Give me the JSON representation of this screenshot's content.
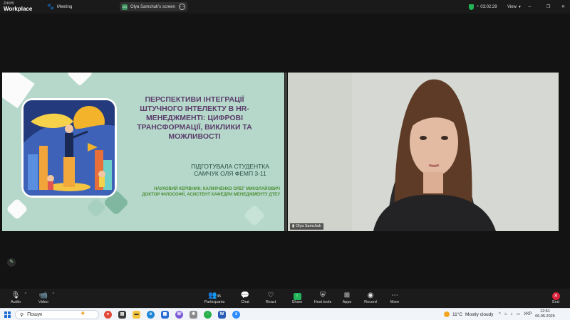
{
  "titlebar": {
    "logo_top": "zoom",
    "logo_bottom": "Workplace",
    "meeting_label": "Meeting",
    "share_badge": "OS",
    "share_label": "Olya Samchuk's screen",
    "timer": "03:02:29",
    "view_label": "View"
  },
  "slide": {
    "title": "ПЕРСПЕКТИВИ ІНТЕГРАЦІЇ ШТУЧНОГО ІНТЕЛЕКТУ В HR-МЕНЕДЖМЕНТІ: ЦИФРОВІ ТРАНСФОРМАЦІЇ, ВИКЛИКИ ТА МОЖЛИВОСТІ",
    "prepared_line1": "ПІДГОТУВАЛА СТУДЕНТКА",
    "prepared_line2": "САМЧУК ОЛЯ ФЕМП 3-11",
    "supervisor_line1": "НАУКОВИЙ КЕРІВНИК: КАЛІНІЧЕНКО ОЛЕГ МИКОЛАЙОВИЧ",
    "supervisor_line2": "ДОКТОР ФІЛОСОФІЇ, АСИСТЕНТ КАФЕДРИ МЕНЕДЖМЕНТУ ДТЕУ"
  },
  "video": {
    "name": "Olya Samchuk"
  },
  "toolbar": {
    "audio": "Audio",
    "video": "Video",
    "participants": "Participants",
    "participants_count": "45",
    "chat": "Chat",
    "react": "React",
    "share": "Share",
    "host_tools": "Host tools",
    "apps": "Apps",
    "record": "Record",
    "more": "More",
    "end": "End"
  },
  "taskbar": {
    "search_placeholder": "Пошук",
    "weather_temp": "11°C",
    "weather_desc": "Mostly cloudy",
    "language": "УКР",
    "time": "12:51",
    "date": "06.05.2025"
  },
  "colors": {
    "slide_bg": "#b5d8cb",
    "title_purple": "#5b3d6b",
    "green_text": "#4e9033",
    "end_red": "#d9233a",
    "share_green": "#21b35a"
  }
}
